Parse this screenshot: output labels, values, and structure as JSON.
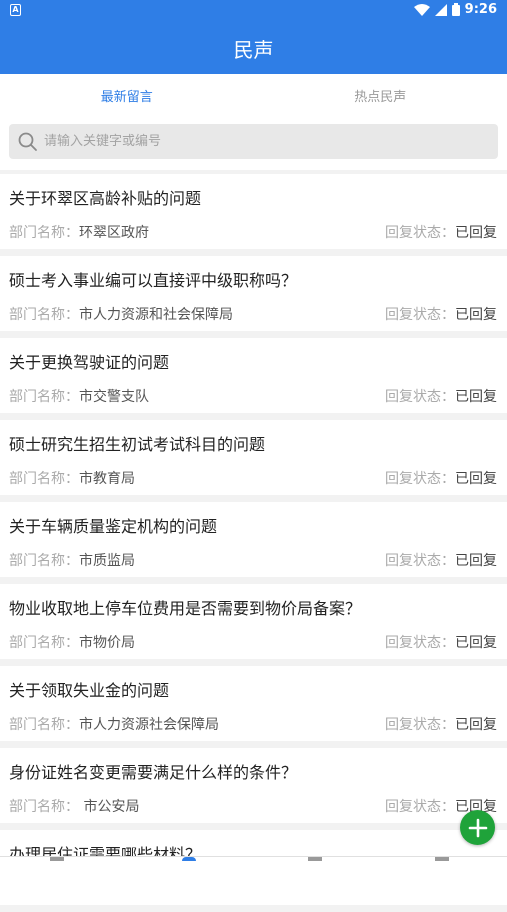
{
  "status_bar": {
    "left_icon": "A",
    "time": "9:26",
    "icons": [
      "wifi-icon",
      "signal-icon",
      "battery-icon"
    ]
  },
  "app_bar": {
    "title": "民声"
  },
  "tabs": [
    {
      "label": "最新留言",
      "active": true
    },
    {
      "label": "热点民声",
      "active": false
    }
  ],
  "search": {
    "placeholder": "请输入关键字或编号",
    "value": ""
  },
  "items": [
    {
      "title": "关于环翠区高龄补贴的问题",
      "dept_label": "部门名称：",
      "dept": "环翠区政府",
      "status_label": "回复状态：",
      "status": "已回复"
    },
    {
      "title": "硕士考入事业编可以直接评中级职称吗？",
      "dept_label": "部门名称：",
      "dept": "市人力资源和社会保障局",
      "status_label": "回复状态：",
      "status": "已回复"
    },
    {
      "title": "关于更换驾驶证的问题",
      "dept_label": "部门名称：",
      "dept": "市交警支队",
      "status_label": "回复状态：",
      "status": "已回复"
    },
    {
      "title": "硕士研究生招生初试考试科目的问题",
      "dept_label": "部门名称：",
      "dept": "市教育局",
      "status_label": "回复状态：",
      "status": "已回复"
    },
    {
      "title": "关于车辆质量鉴定机构的问题",
      "dept_label": "部门名称：",
      "dept": "市质监局",
      "status_label": "回复状态：",
      "status": "已回复"
    },
    {
      "title": "物业收取地上停车位费用是否需要到物价局备案？",
      "dept_label": "部门名称：",
      "dept": "市物价局",
      "status_label": "回复状态：",
      "status": "已回复"
    },
    {
      "title": "关于领取失业金的问题",
      "dept_label": "部门名称：",
      "dept": "市人力资源社会保障局",
      "status_label": "回复状态：",
      "status": "已回复"
    },
    {
      "title": "身份证姓名变更需要满足什么样的条件？",
      "dept_label": "部门名称：",
      "dept": " 市公安局",
      "status_label": "回复状态：",
      "status": "已回复"
    },
    {
      "title": "办理居住证需要哪些材料？",
      "dept_label": "",
      "dept": "",
      "status_label": "",
      "status": ""
    }
  ],
  "fab": {
    "icon": "plus-icon"
  },
  "colors": {
    "primary": "#2f7ee6",
    "fab": "#1fa33a"
  }
}
